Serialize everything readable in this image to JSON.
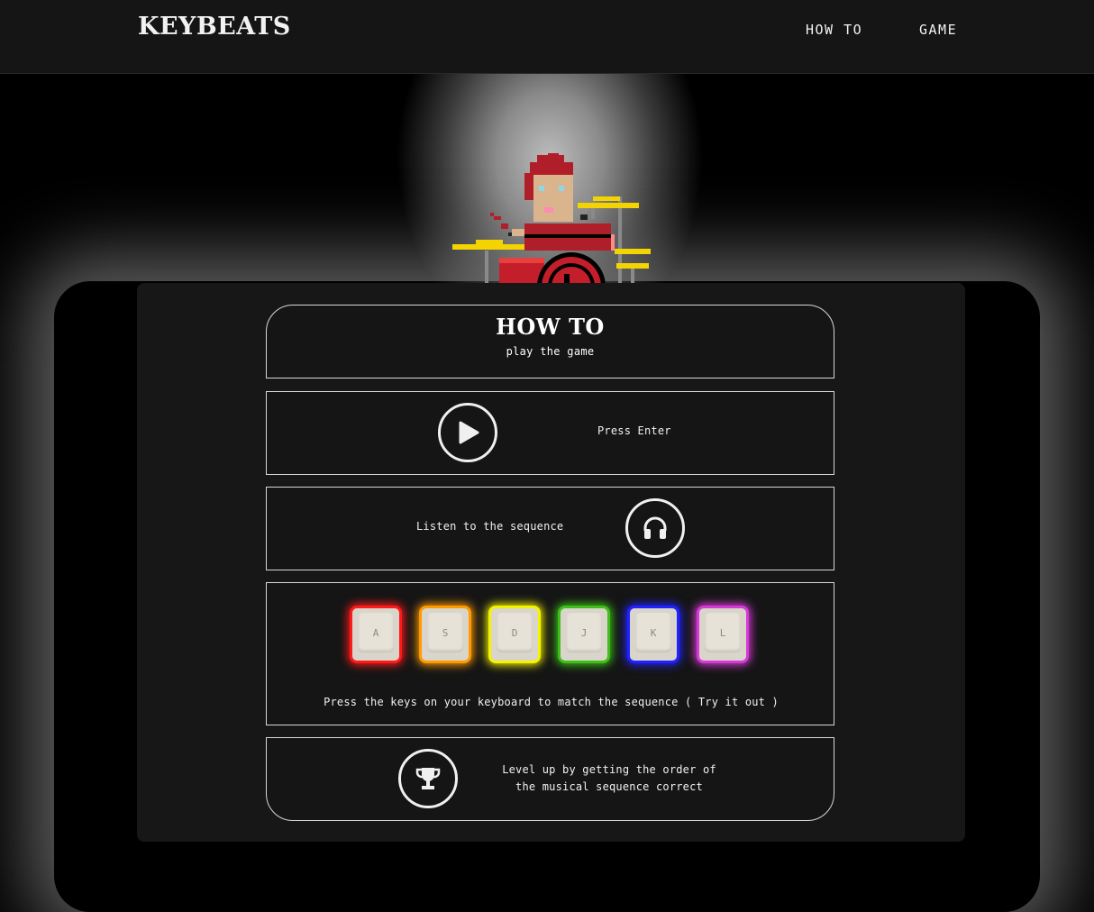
{
  "header": {
    "brand": "KEYBEATS",
    "nav": [
      {
        "label": "HOW TO"
      },
      {
        "label": "GAME"
      }
    ]
  },
  "howto": {
    "title": "HOW TO",
    "subtitle": "play the game",
    "steps": [
      {
        "text": "Press Enter",
        "icon": "play-icon"
      },
      {
        "text": "Listen to the sequence",
        "icon": "headphones-icon"
      },
      {
        "text": "Press the keys on your keyboard to match the sequence ( Try it out )",
        "icon": "keyboard-keys"
      },
      {
        "text_line1": "Level up by getting the order of",
        "text_line2": "the musical sequence correct",
        "icon": "trophy-icon"
      }
    ],
    "keys": [
      {
        "label": "A",
        "color": "#ff1a1a"
      },
      {
        "label": "S",
        "color": "#ff9a00"
      },
      {
        "label": "D",
        "color": "#f4f400"
      },
      {
        "label": "J",
        "color": "#3fbf1a"
      },
      {
        "label": "K",
        "color": "#2222ff"
      },
      {
        "label": "L",
        "color": "#d63ad6"
      }
    ]
  },
  "colors": {
    "background": "#000000",
    "panel": "#171717",
    "text": "#f2f2f2"
  }
}
